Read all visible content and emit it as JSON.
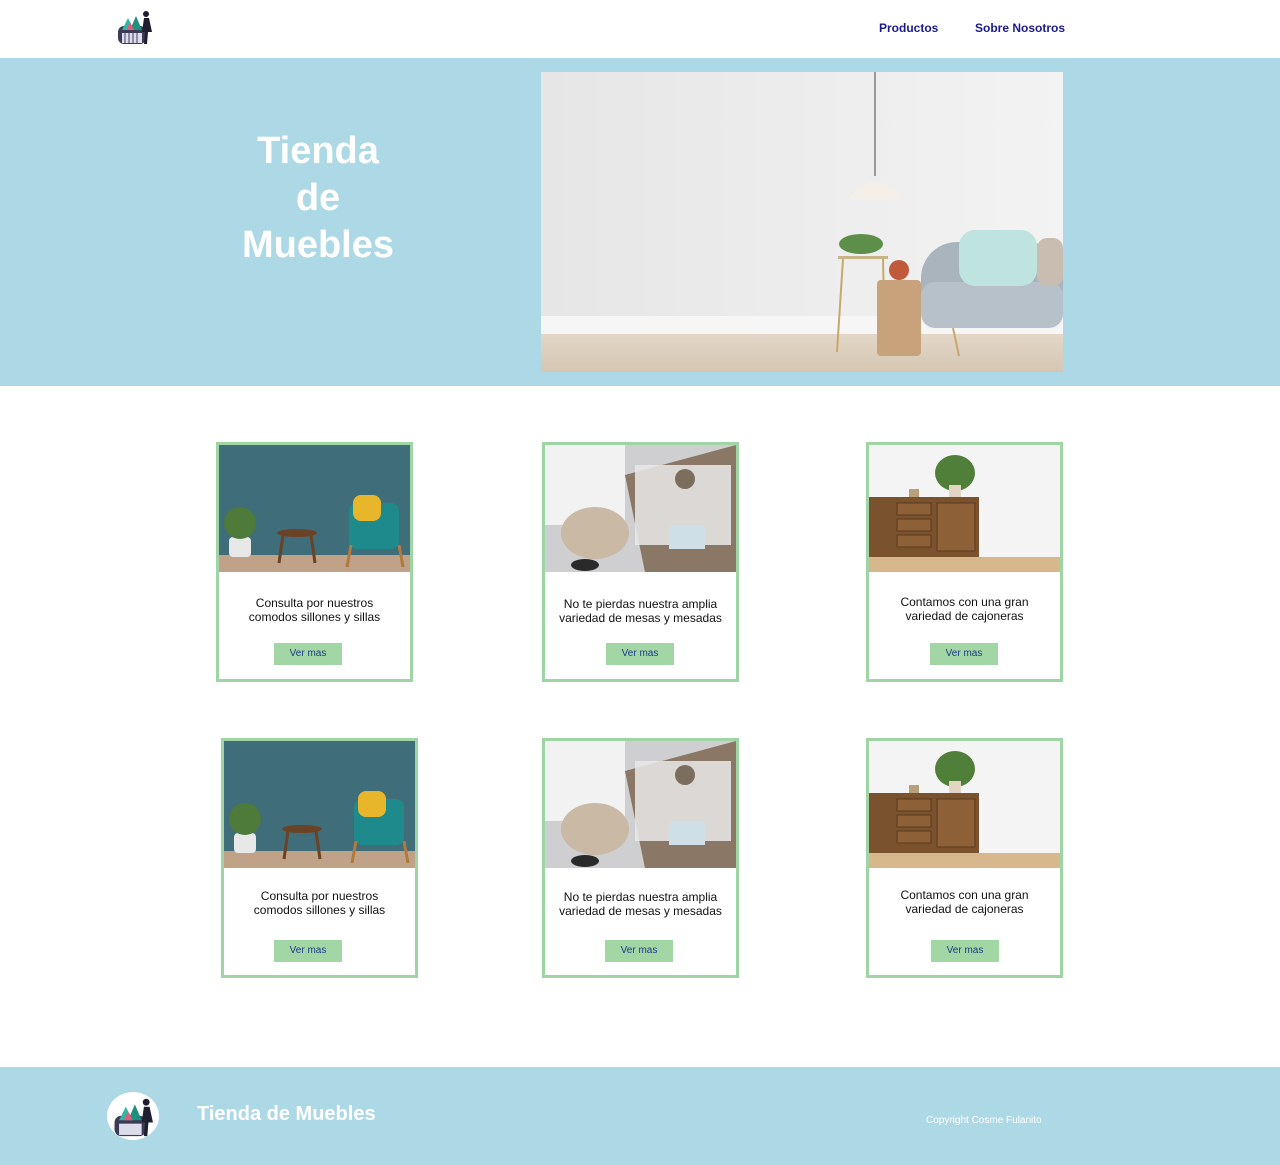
{
  "header": {
    "logo_icon": "store-logo-icon",
    "nav": [
      {
        "label": "Productos"
      },
      {
        "label": "Sobre Nosotros"
      }
    ]
  },
  "hero": {
    "title_line1": "Tienda",
    "title_line2": "de",
    "title_line3": "Muebles",
    "image": "living-room-sofa-lamp-image"
  },
  "cards": [
    {
      "image": "armchair-image",
      "text": "Consulta por nuestros comodos sillones y sillas",
      "button": "Ver mas"
    },
    {
      "image": "bedside-table-image",
      "text": "No te pierdas nuestra amplia variedad de mesas y mesadas",
      "button": "Ver mas"
    },
    {
      "image": "sideboard-image",
      "text": "Contamos con una gran variedad de cajoneras",
      "button": "Ver mas"
    },
    {
      "image": "armchair-image",
      "text": "Consulta por nuestros comodos sillones y sillas",
      "button": "Ver mas"
    },
    {
      "image": "bedside-table-image",
      "text": "No te pierdas nuestra amplia variedad de mesas y mesadas",
      "button": "Ver mas"
    },
    {
      "image": "sideboard-image",
      "text": "Contamos con una gran variedad de cajoneras",
      "button": "Ver mas"
    }
  ],
  "footer": {
    "title": "Tienda de Muebles",
    "copyright": "Copyright Cosme Fulanito"
  },
  "colors": {
    "hero_bg": "#add8e6",
    "card_border": "#9fd5a5",
    "button_bg": "#a2d6a4",
    "nav_text": "#1a1a8c"
  }
}
